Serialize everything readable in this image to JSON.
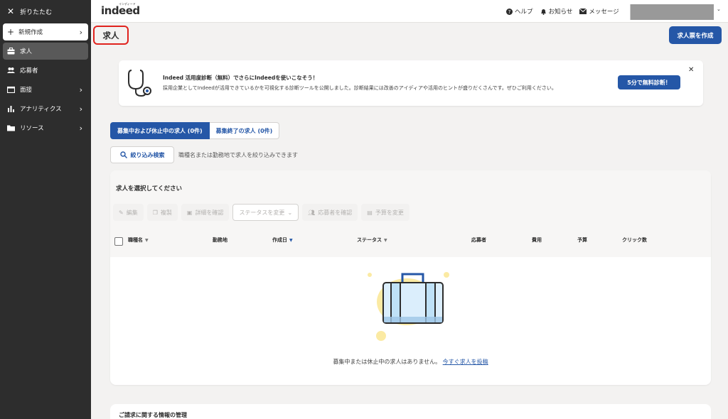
{
  "sidebar": {
    "collapse_label": "折りたたむ",
    "new_label": "新規作成",
    "items": [
      {
        "label": "求人",
        "icon": "briefcase-icon"
      },
      {
        "label": "応募者",
        "icon": "people-icon"
      },
      {
        "label": "面接",
        "icon": "calendar-icon"
      },
      {
        "label": "アナリティクス",
        "icon": "bar-chart-icon"
      },
      {
        "label": "リソース",
        "icon": "folder-icon"
      }
    ]
  },
  "header": {
    "logo": "indeed",
    "logo_sup": "インディード",
    "help": "ヘルプ",
    "notifications": "お知らせ",
    "messages": "メッセージ"
  },
  "page": {
    "title": "求人",
    "create_button": "求人票を作成"
  },
  "banner": {
    "title": "Indeed 活用度診断（無料）でさらにIndeedを使いこなそう！",
    "description": "採用企業としてIndeedが活用できているかを可視化する診断ツールを公開しました。診断結果には改善のアイディアや活用のヒントが盛りだくさんです。ぜひご利用ください。",
    "button": "5分で無料診断！"
  },
  "tabs": [
    {
      "label": "募集中および休止中の求人 (0件)"
    },
    {
      "label": "募集終了の求人 (0件)"
    }
  ],
  "filter": {
    "button": "絞り込み検索",
    "hint": "職種名または勤務地で求人を絞り込みできます"
  },
  "card": {
    "title": "求人を選択してください",
    "actions": {
      "edit": "編集",
      "copy": "複製",
      "details": "詳細を確認",
      "status": "ステータスを変更",
      "applicants": "応募者を確認",
      "budget": "予算を変更"
    },
    "columns": {
      "title": "職種名",
      "location": "勤務地",
      "created": "作成日",
      "status": "ステータス",
      "applicants": "応募者",
      "cost": "費用",
      "budget": "予算",
      "clicks": "クリック数"
    },
    "empty_text": "募集中または休止中の求人はありません。",
    "empty_link": "今すぐ求人を投稿"
  },
  "card2": {
    "title": "ご請求に関する情報の管理"
  },
  "colors": {
    "primary": "#2557a7",
    "sidebar": "#2d2d2d",
    "highlight": "#e0231e"
  }
}
